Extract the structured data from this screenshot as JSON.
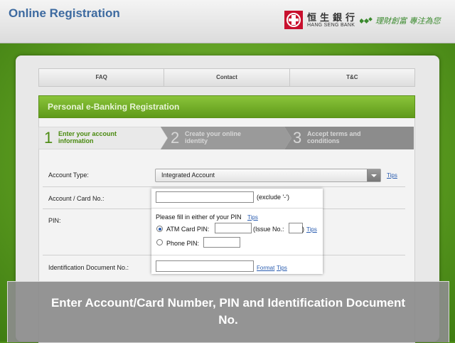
{
  "header": {
    "title": "Online Registration",
    "bank_name_cn": "恒生銀行",
    "bank_name_en": "HANG SENG BANK",
    "slogan": "理財創富 專注為您"
  },
  "nav": {
    "tabs": [
      "FAQ",
      "Contact",
      "T&C"
    ]
  },
  "registration": {
    "title": "Personal e-Banking Registration",
    "steps": [
      {
        "number": "1",
        "label": "Enter your account information",
        "active": true
      },
      {
        "number": "2",
        "label": "Create your online identity",
        "active": false
      },
      {
        "number": "3",
        "label": "Accept terms and conditions",
        "active": false
      }
    ]
  },
  "form": {
    "account_type_label": "Account Type:",
    "account_type_value": "Integrated Account",
    "tips": "Tips",
    "account_card_label": "Account / Card No.:",
    "account_card_value": "",
    "exclude_hint": "(exclude '-')",
    "pin_label": "PIN:",
    "pin_hint": "Please fill in either of your PIN",
    "atm_pin_label": "ATM Card PIN:",
    "atm_pin_value": "",
    "issue_no_label": "(Issue No.:",
    "issue_no_close": ")",
    "issue_no_value": "",
    "phone_pin_label": "Phone PIN:",
    "phone_pin_value": "",
    "id_doc_label": "Identification Document No.:",
    "id_doc_value": "",
    "format_link": "Format"
  },
  "overlay": {
    "caption": "Enter Account/Card Number, PIN and Identification Document No."
  },
  "colors": {
    "brand_green": "#5f9a1a",
    "link_blue": "#2a5db0",
    "title_blue": "#3d6aa0"
  }
}
